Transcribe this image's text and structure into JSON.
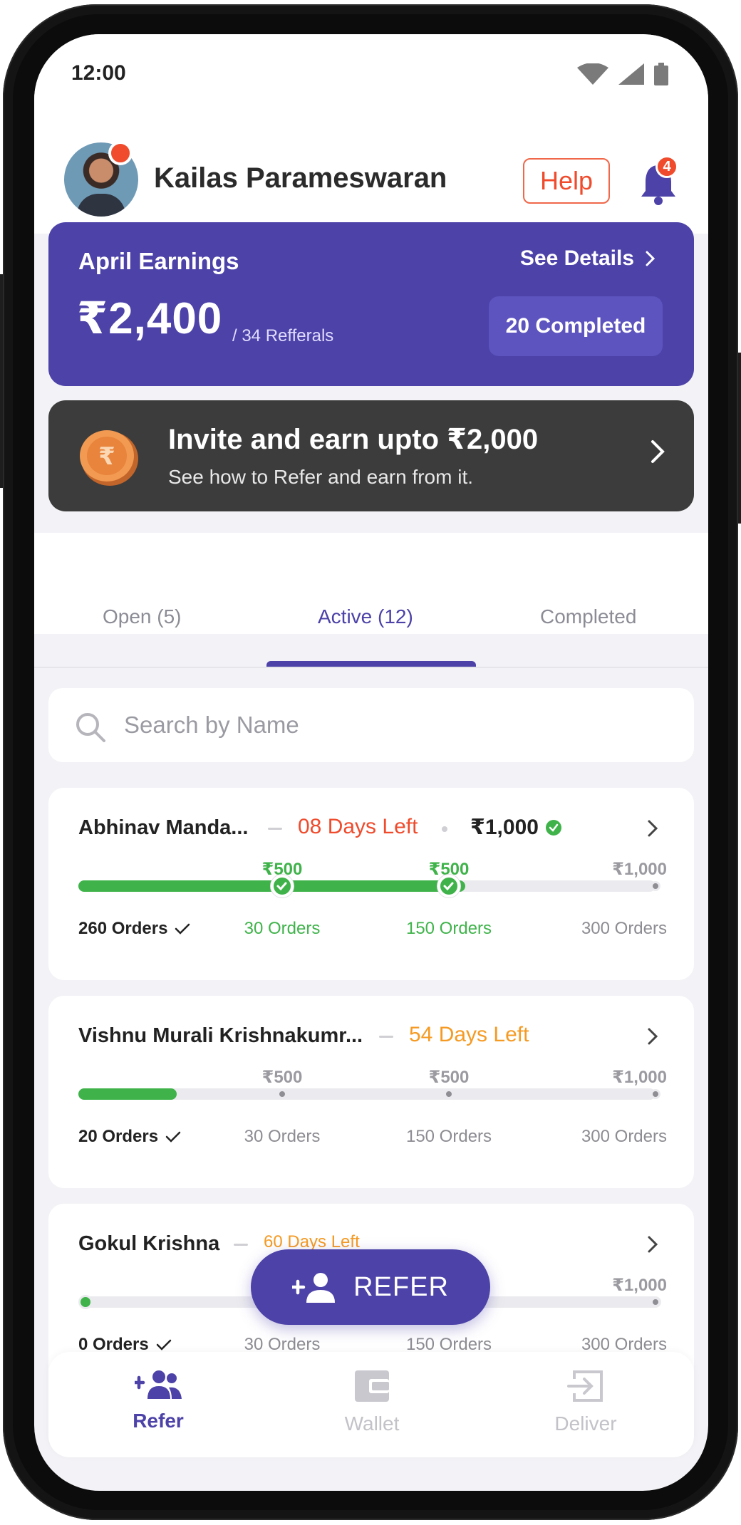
{
  "status_bar": {
    "time": "12:00"
  },
  "header": {
    "user_name": "Kailas Parameswaran",
    "help_label": "Help",
    "notification_count": "4"
  },
  "earnings": {
    "title": "April Earnings",
    "see_details": "See Details",
    "amount": "₹2,400",
    "referrals": "/ 34 Refferals",
    "completed": "20 Completed"
  },
  "invite": {
    "title": "Invite and earn upto ₹2,000",
    "subtitle": "See how to Refer and earn from it."
  },
  "tabs": [
    {
      "label": "Open (5)"
    },
    {
      "label": "Active (12)"
    },
    {
      "label": "Completed"
    }
  ],
  "search": {
    "placeholder": "Search by Name"
  },
  "referrals": [
    {
      "name": "Abhinav Manda...",
      "days_left": "08 Days Left",
      "payout": "₹1,000",
      "orders_done": "260 Orders",
      "progress": 0.67,
      "milestones": [
        {
          "amount": "₹500",
          "orders": "30 Orders",
          "achieved": true
        },
        {
          "amount": "₹500",
          "orders": "150 Orders",
          "achieved": true
        },
        {
          "amount": "₹1,000",
          "orders": "300 Orders",
          "achieved": false
        }
      ]
    },
    {
      "name": "Vishnu Murali Krishnakumr...",
      "days_left": "54 Days Left",
      "orders_done": "20 Orders",
      "progress": 0.17,
      "milestones": [
        {
          "amount": "₹500",
          "orders": "30 Orders",
          "achieved": false
        },
        {
          "amount": "₹500",
          "orders": "150 Orders",
          "achieved": false
        },
        {
          "amount": "₹1,000",
          "orders": "300 Orders",
          "achieved": false
        }
      ]
    },
    {
      "name": "Gokul Krishna",
      "days_left": "60 Days Left",
      "orders_done": "0 Orders",
      "progress": 0,
      "milestones": [
        {
          "amount": "",
          "orders": "30 Orders",
          "achieved": false
        },
        {
          "amount": "",
          "orders": "150 Orders",
          "achieved": false
        },
        {
          "amount": "₹1,000",
          "orders": "300 Orders",
          "achieved": false
        }
      ]
    }
  ],
  "fab": {
    "label": "REFER"
  },
  "bottom_nav": [
    {
      "label": "Refer",
      "icon": "refer-people-icon"
    },
    {
      "label": "Wallet",
      "icon": "wallet-icon"
    },
    {
      "label": "Deliver",
      "icon": "deliver-icon"
    }
  ],
  "colors": {
    "primary": "#4c42a8",
    "danger": "#ef4b2c",
    "warning": "#f59a23",
    "success": "#3fb34a",
    "invite_bg": "#3c3c3c"
  }
}
